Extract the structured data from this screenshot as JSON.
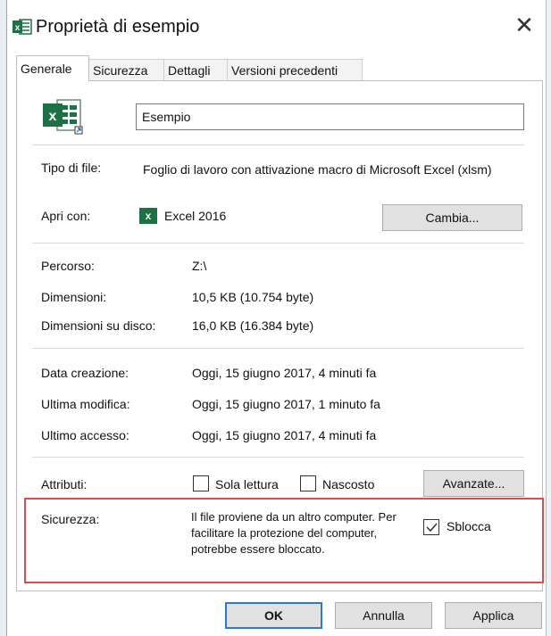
{
  "window": {
    "title": "Proprietà di esempio",
    "close_glyph": "✕",
    "icons": {
      "title_icon": "excel-file-icon",
      "close": "close-icon"
    }
  },
  "tabs": [
    {
      "label": "Generale",
      "active": true
    },
    {
      "label": "Sicurezza",
      "active": false
    },
    {
      "label": "Dettagli",
      "active": false
    },
    {
      "label": "Versioni precedenti",
      "active": false
    }
  ],
  "general": {
    "file_name": "Esempio",
    "file_type_label": "Tipo di file:",
    "file_type_value": "Foglio di lavoro con attivazione macro di Microsoft Excel (xlsm)",
    "opens_with_label": "Apri con:",
    "opens_with_value": "Excel 2016",
    "change_button": "Cambia...",
    "location_label": "Percorso:",
    "location_value": "Z:\\",
    "size_label": "Dimensioni:",
    "size_value": "10,5 KB (10.754 byte)",
    "size_on_disk_label": "Dimensioni su disco:",
    "size_on_disk_value": "16,0 KB (16.384 byte)",
    "created_label": "Data creazione:",
    "created_value": "Oggi, 15 giugno 2017, 4 minuti fa",
    "modified_label": "Ultima modifica:",
    "modified_value": "Oggi, 15 giugno 2017, 1 minuto fa",
    "accessed_label": "Ultimo accesso:",
    "accessed_value": "Oggi, 15 giugno 2017, 4 minuti fa",
    "attributes_label": "Attributi:",
    "readonly_label": "Sola lettura",
    "readonly_checked": false,
    "hidden_label": "Nascosto",
    "hidden_checked": false,
    "advanced_button": "Avanzate...",
    "security_label": "Sicurezza:",
    "security_text": "Il file proviene da un altro computer. Per facilitare la protezione del computer, potrebbe essere bloccato.",
    "unblock_label": "Sblocca",
    "unblock_checked": true
  },
  "footer": {
    "ok": "OK",
    "cancel": "Annulla",
    "apply": "Applica"
  },
  "colors": {
    "highlight": "#d94d4d",
    "excel_green": "#1e7145",
    "button_bg": "#e1e1e1"
  }
}
